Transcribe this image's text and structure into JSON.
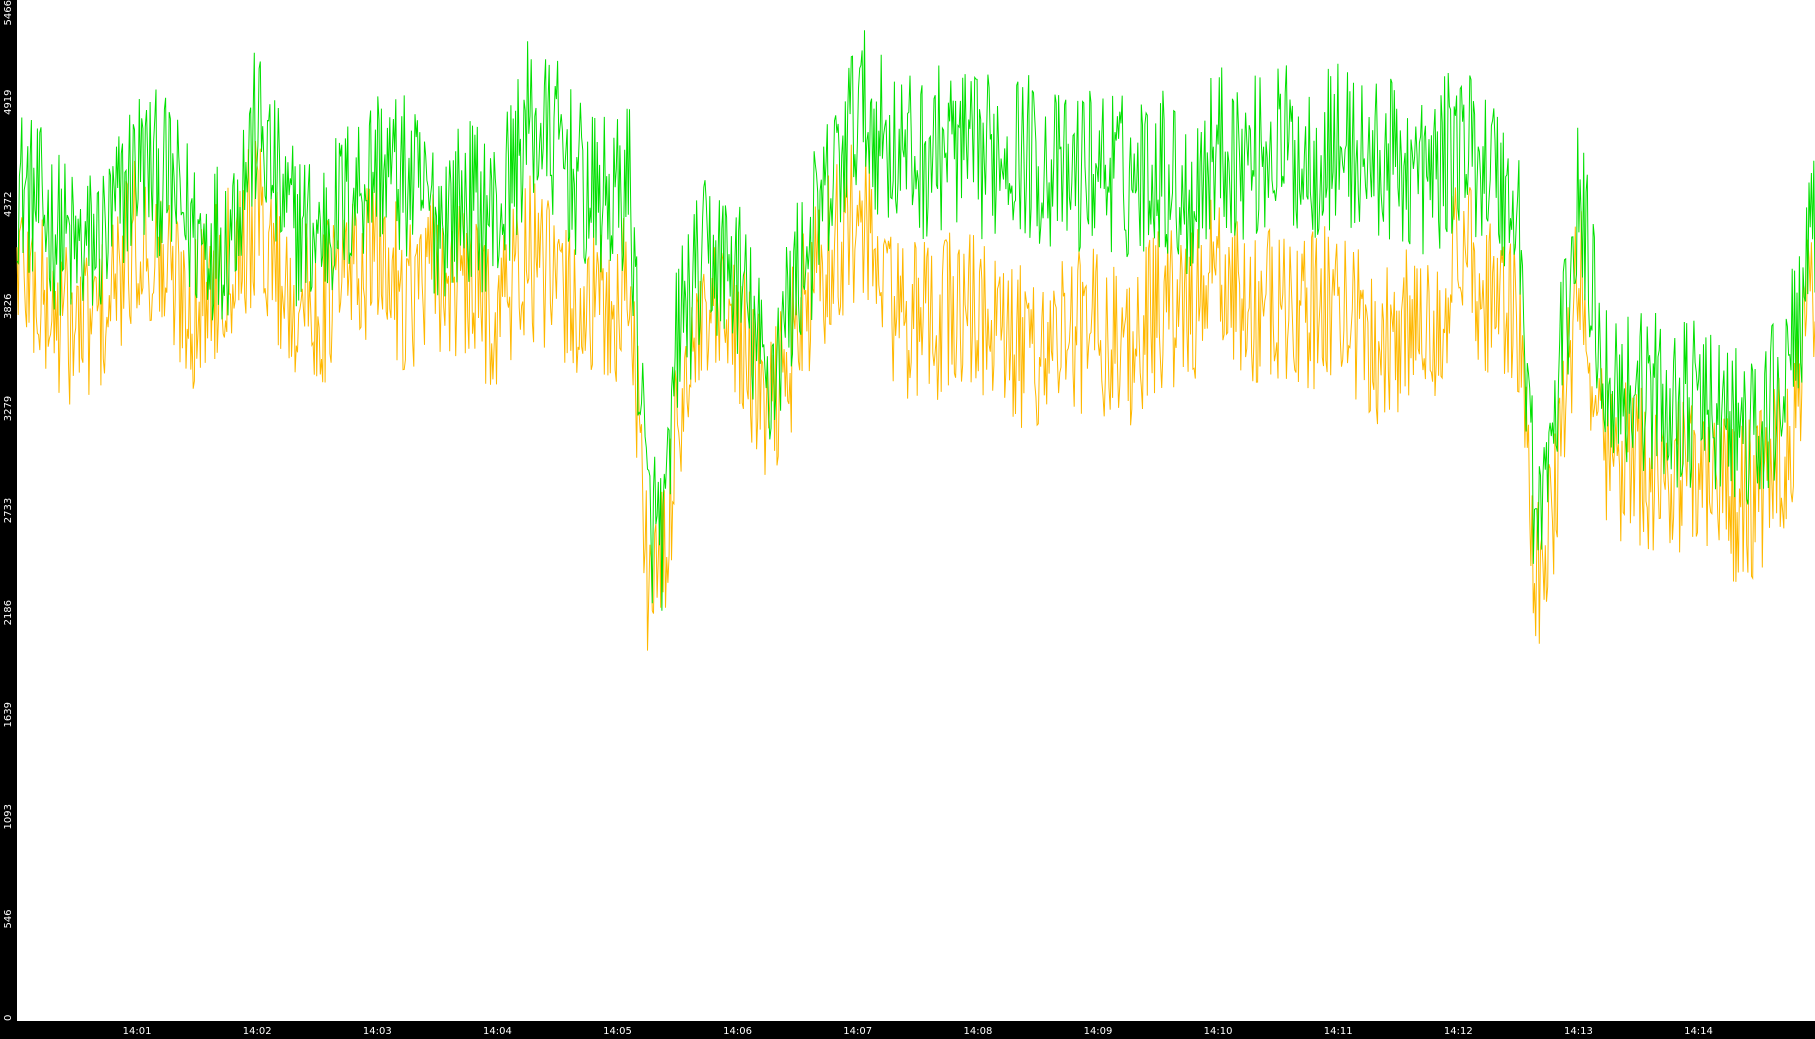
{
  "chart_data": {
    "type": "line",
    "title": "",
    "xlabel": "",
    "ylabel": "",
    "background_color": "#000000",
    "plot_background_color": "#ffffff",
    "axis_label_color": "#ffffff",
    "grid": false,
    "legend": "none",
    "x_unit": "minute of 14:00 hour",
    "xlim": [
      0,
      14.97
    ],
    "ylim": [
      0,
      5466
    ],
    "y_ticks": [
      0,
      546,
      1093,
      1639,
      2186,
      2733,
      3279,
      3826,
      4372,
      4919,
      5466
    ],
    "x_ticks": [
      {
        "value": 1,
        "label": "14:01"
      },
      {
        "value": 2,
        "label": "14:02"
      },
      {
        "value": 3,
        "label": "14:03"
      },
      {
        "value": 4,
        "label": "14:04"
      },
      {
        "value": 5,
        "label": "14:05"
      },
      {
        "value": 6,
        "label": "14:06"
      },
      {
        "value": 7,
        "label": "14:07"
      },
      {
        "value": 8,
        "label": "14:08"
      },
      {
        "value": 9,
        "label": "14:09"
      },
      {
        "value": 10,
        "label": "14:10"
      },
      {
        "value": 11,
        "label": "14:11"
      },
      {
        "value": 12,
        "label": "14:12"
      },
      {
        "value": 13,
        "label": "14:13"
      },
      {
        "value": 14,
        "label": "14:14"
      }
    ],
    "series": [
      {
        "color": "#00e000",
        "x": [
          0,
          0.25,
          0.5,
          0.75,
          1,
          1.25,
          1.5,
          1.75,
          2,
          2.25,
          2.5,
          2.75,
          3,
          3.25,
          3.5,
          3.75,
          4,
          4.25,
          4.5,
          4.75,
          5,
          5.1,
          5.25,
          5.4,
          5.5,
          5.75,
          6,
          6.25,
          6.5,
          6.75,
          7,
          7.25,
          7.5,
          7.75,
          8,
          8.25,
          8.5,
          8.75,
          9,
          9.25,
          9.5,
          9.75,
          10,
          10.25,
          10.5,
          10.75,
          11,
          11.25,
          11.5,
          11.75,
          12,
          12.25,
          12.5,
          12.65,
          12.8,
          13,
          13.25,
          13.5,
          13.75,
          14,
          14.25,
          14.5,
          14.75,
          14.97
        ],
        "y": [
          4500,
          4300,
          4100,
          4200,
          4600,
          4500,
          4200,
          4200,
          4800,
          4300,
          4200,
          4400,
          4600,
          4500,
          4300,
          4400,
          4300,
          4800,
          4700,
          4400,
          4400,
          4500,
          2700,
          2600,
          3700,
          4100,
          4000,
          3400,
          4000,
          4400,
          4900,
          4700,
          4600,
          4700,
          4600,
          4700,
          4600,
          4500,
          4600,
          4500,
          4600,
          4400,
          4700,
          4600,
          4700,
          4600,
          4700,
          4600,
          4600,
          4500,
          4700,
          4600,
          4300,
          2600,
          3200,
          4400,
          3400,
          3400,
          3300,
          3300,
          3200,
          3100,
          3500,
          4200
        ]
      },
      {
        "color": "#ffb800",
        "x": [
          0,
          0.25,
          0.5,
          0.75,
          1,
          1.25,
          1.5,
          1.75,
          2,
          2.25,
          2.5,
          2.75,
          3,
          3.25,
          3.5,
          3.75,
          4,
          4.25,
          4.5,
          4.75,
          5,
          5.1,
          5.25,
          5.4,
          5.5,
          5.75,
          6,
          6.25,
          6.5,
          6.75,
          7,
          7.25,
          7.5,
          7.75,
          8,
          8.25,
          8.5,
          8.75,
          9,
          9.25,
          9.5,
          9.75,
          10,
          10.25,
          10.5,
          10.75,
          11,
          11.25,
          11.5,
          11.75,
          12,
          12.25,
          12.5,
          12.65,
          12.8,
          13,
          13.25,
          13.5,
          13.75,
          14,
          14.25,
          14.5,
          14.75,
          14.97
        ],
        "y": [
          4100,
          3800,
          3700,
          3800,
          4200,
          4000,
          3800,
          4100,
          4300,
          3900,
          3800,
          4000,
          4100,
          3900,
          4000,
          3900,
          3800,
          4100,
          3900,
          3800,
          3800,
          4000,
          2400,
          2400,
          3300,
          3700,
          3700,
          3200,
          3700,
          4100,
          4300,
          3900,
          3700,
          3800,
          3800,
          3600,
          3600,
          3700,
          3700,
          3600,
          3800,
          3800,
          4000,
          3800,
          3800,
          3800,
          3900,
          3600,
          3700,
          3700,
          4100,
          3900,
          3700,
          2300,
          2700,
          4000,
          3000,
          3000,
          2900,
          3000,
          2800,
          2800,
          3100,
          4000
        ]
      }
    ]
  }
}
